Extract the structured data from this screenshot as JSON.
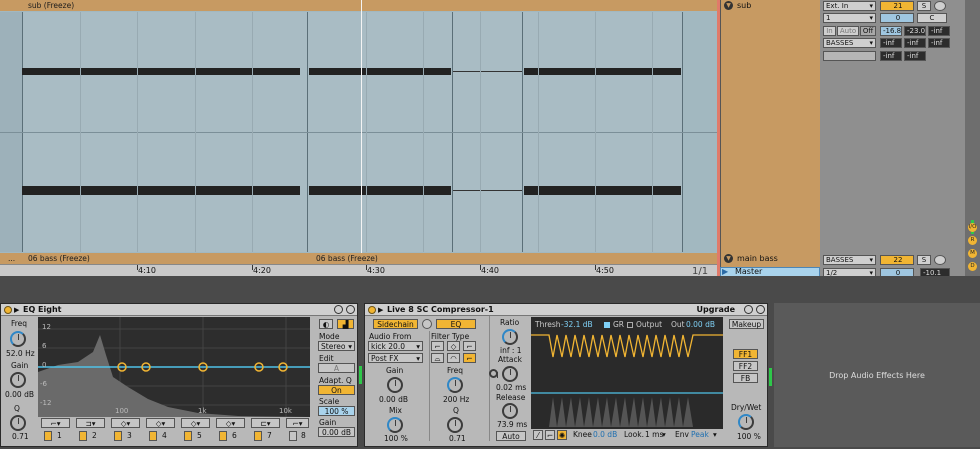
{
  "arrangement": {
    "top_clip_label": "sub (Freeze)",
    "bottom_clip_label_a": "06 bass (Freeze)",
    "bottom_clip_label_b": "06 bass (Freeze)",
    "ellipsis": "...",
    "ruler": [
      "4:10",
      "4:20",
      "4:30",
      "4:40",
      "4:50"
    ],
    "scroll_indicator": "1/1"
  },
  "tracks": {
    "sub": {
      "name": "sub",
      "input": "Ext. In",
      "channel": "1",
      "monitor": [
        "In",
        "Auto",
        "Off"
      ],
      "output": "BASSES",
      "number": "21",
      "solo": "S",
      "pan": "C",
      "vol": "0",
      "meter_a": "-16.8",
      "meter_b": "-23.0",
      "send_a": "-inf",
      "send_b": "-inf",
      "send_c": "-inf",
      "send_d": "-inf"
    },
    "main_bass": {
      "name": "main bass",
      "output": "BASSES",
      "number": "22",
      "solo": "S"
    },
    "master": {
      "name": "Master",
      "output": "1/2",
      "vol": "0",
      "meter": "-10.1"
    }
  },
  "side_buttons": [
    "I/O",
    "R",
    "M",
    "D"
  ],
  "eq_eight": {
    "title": "EQ Eight",
    "freq_label": "Freq",
    "freq_value": "52.0 Hz",
    "gain_label": "Gain",
    "gain_value": "0.00 dB",
    "q_label": "Q",
    "q_value": "0.71",
    "y_axis": [
      "12",
      "6",
      "0",
      "-6",
      "-12"
    ],
    "x_axis": [
      "100",
      "1k",
      "10k"
    ],
    "bands": [
      "1",
      "2",
      "3",
      "4",
      "5",
      "6",
      "7",
      "8"
    ],
    "mode_label": "Mode",
    "mode_value": "Stereo",
    "edit_label": "Edit",
    "edit_value": "A",
    "adapt_q_label": "Adapt. Q",
    "adapt_q_value": "On",
    "scale_label": "Scale",
    "scale_value": "100 %",
    "out_gain_label": "Gain",
    "out_gain_value": "0.00 dB"
  },
  "compressor": {
    "title": "Live 8 SC Compressor-1",
    "upgrade": "Upgrade",
    "sidechain": "Sidechain",
    "eq": "EQ",
    "audio_from_label": "Audio From",
    "audio_from_value": "kick 20.0",
    "post_fx": "Post FX",
    "filter_type_label": "Filter Type",
    "gain_label": "Gain",
    "gain_value": "0.00 dB",
    "mix_label": "Mix",
    "mix_value": "100 %",
    "freq_label": "Freq",
    "freq_value": "200 Hz",
    "q_label": "Q",
    "q_value": "0.71",
    "ratio_label": "Ratio",
    "ratio_value": "inf : 1",
    "attack_label": "Attack",
    "attack_value": "0.02 ms",
    "release_label": "Release",
    "release_value": "73.9 ms",
    "auto": "Auto",
    "thresh_label": "Thresh",
    "thresh_value": "-32.1 dB",
    "gr_label": "GR",
    "output_label": "Output",
    "out_label": "Out",
    "out_value": "0.00 dB",
    "knee_label": "Knee",
    "knee_value": "0.0 dB",
    "look_label": "Look.",
    "look_value": "1 ms",
    "env_label": "Env",
    "env_value": "Peak",
    "makeup": "Makeup",
    "ff1": "FF1",
    "ff2": "FF2",
    "fb": "FB",
    "drywet_label": "Dry/Wet",
    "drywet_value": "100 %"
  },
  "drop_zone": "Drop Audio Effects Here"
}
